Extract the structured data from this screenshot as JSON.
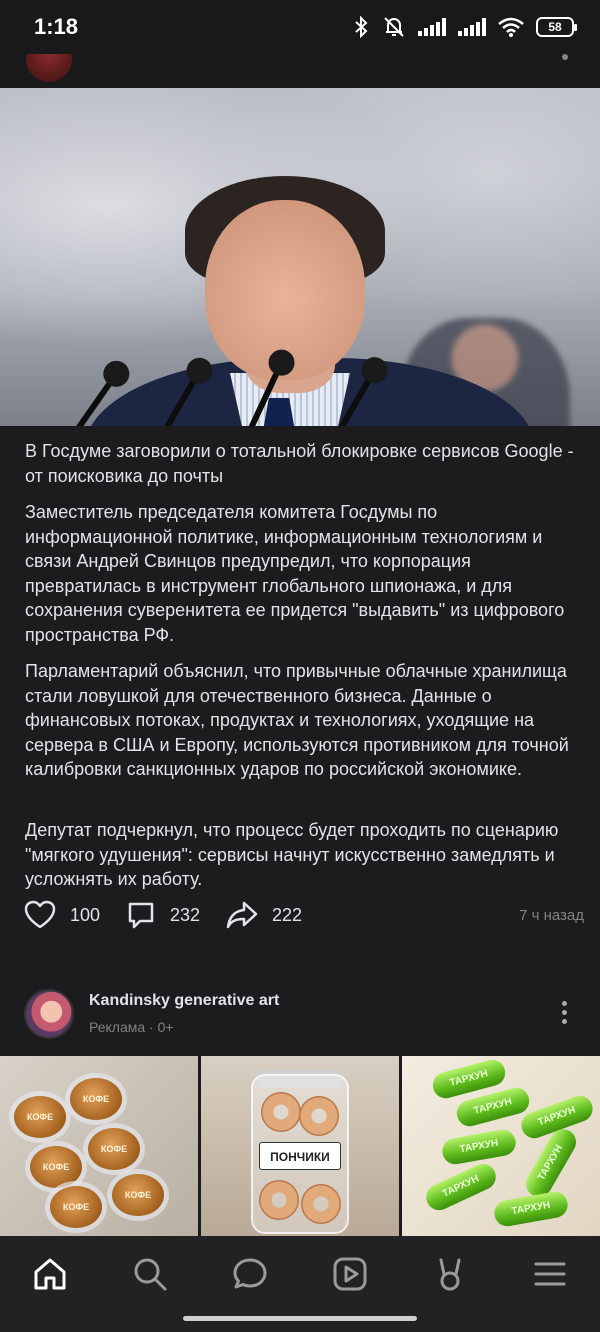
{
  "status_bar": {
    "time": "1:18",
    "battery": "58",
    "icons": [
      "bluetooth-icon",
      "mute-icon",
      "signal-icon",
      "signal-icon",
      "wifi-icon",
      "battery-icon"
    ]
  },
  "post": {
    "title": "В Госдуме заговорили о тотальной блокировке сервисов Google - от поисковика до почты",
    "paragraphs": [
      "Заместитель председателя комитета Госдумы по информационной политике, информационным технологиям и связи Андрей Свинцов предупредил, что корпорация превратилась в инструмент глобального шпионажа, и для сохранения суверенитета ее придется \"выдавить\" из цифрового пространства РФ.",
      "Парламентарий объяснил, что привычные облачные хранилища стали ловушкой для отечественного бизнеса. Данные о финансовых потоках, продуктах и технологиях, уходящие на сервера в США и Европу, используются противником для точной калибровки санкционных ударов по российской экономике.",
      "Депутат подчеркнул, что процесс будет проходить по сценарию \"мягкого удушения\": сервисы начнут искусственно замедлять и усложнять их работу."
    ],
    "likes": "100",
    "comments": "232",
    "shares": "222",
    "time_ago": "7 ч назад"
  },
  "ad": {
    "name": "Kandinsky generative art",
    "meta": "Реклама · 0+",
    "coffee_label": "КОФЕ",
    "jar_label": "ПОНЧИКИ",
    "capsule_label": "ТАРХУН"
  },
  "bottom_nav": {
    "items": [
      "home-icon",
      "search-icon",
      "messages-icon",
      "video-icon",
      "clips-icon",
      "menu-icon"
    ]
  },
  "colors": {
    "background": "#1c1c1e",
    "text": "#e1e3e6",
    "secondary": "#828282",
    "nav_bg": "#222224"
  }
}
